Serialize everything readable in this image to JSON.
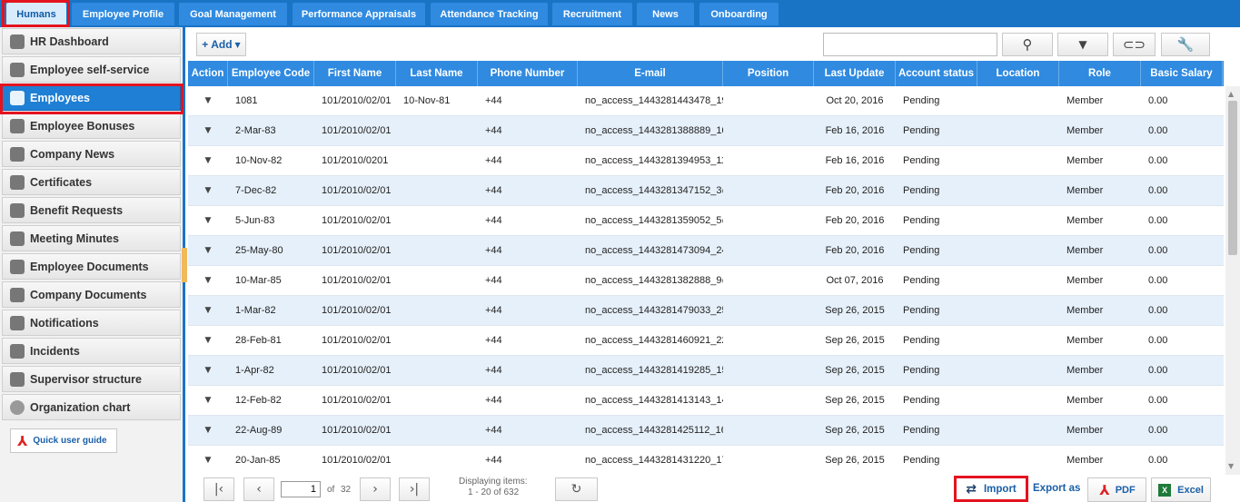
{
  "top_nav": {
    "tabs": [
      {
        "label": "Humans"
      },
      {
        "label": "Employee Profile"
      },
      {
        "label": "Goal Management"
      },
      {
        "label": "Performance Appraisals"
      },
      {
        "label": "Attendance Tracking"
      },
      {
        "label": "Recruitment"
      },
      {
        "label": "News"
      },
      {
        "label": "Onboarding"
      }
    ],
    "active_tab": "Humans"
  },
  "sidebar": {
    "items": [
      {
        "label": "HR Dashboard",
        "icon": "dashboard-icon"
      },
      {
        "label": "Employee self-service",
        "icon": "person-icon"
      },
      {
        "label": "Employees",
        "icon": "employee-card-icon"
      },
      {
        "label": "Employee Bonuses",
        "icon": "bonus-icon"
      },
      {
        "label": "Company News",
        "icon": "newspaper-icon"
      },
      {
        "label": "Certificates",
        "icon": "certificate-icon"
      },
      {
        "label": "Benefit Requests",
        "icon": "stack-icon"
      },
      {
        "label": "Meeting Minutes",
        "icon": "notepad-icon"
      },
      {
        "label": "Employee Documents",
        "icon": "document-icon"
      },
      {
        "label": "Company Documents",
        "icon": "document-icon"
      },
      {
        "label": "Notifications",
        "icon": "building-icon"
      },
      {
        "label": "Incidents",
        "icon": "incident-icon"
      },
      {
        "label": "Supervisor structure",
        "icon": "hierarchy-icon"
      },
      {
        "label": "Organization chart",
        "icon": "circle-icon"
      }
    ],
    "active_item": "Employees",
    "guide_label": "Quick user guide"
  },
  "toolbar": {
    "add_label": "+ Add",
    "search_value": ""
  },
  "grid": {
    "columns": [
      "Action",
      "Employee Code",
      "First Name",
      "Last Name",
      "Phone Number",
      "E-mail",
      "Position",
      "Last Update",
      "Account status",
      "Location",
      "Role",
      "Basic Salary"
    ],
    "rows": [
      {
        "code": "1081",
        "first": "101/2010/02/01",
        "last": "10-Nov-81",
        "phone": "+44",
        "email": "no_access_1443281443478_19",
        "position": "",
        "updated": "Oct 20, 2016",
        "status": "Pending",
        "location": "",
        "role": "Member",
        "salary": "0.00"
      },
      {
        "code": "2-Mar-83",
        "first": "101/2010/02/01",
        "last": "",
        "phone": "+44",
        "email": "no_access_1443281388889_10",
        "position": "",
        "updated": "Feb 16, 2016",
        "status": "Pending",
        "location": "",
        "role": "Member",
        "salary": "0.00"
      },
      {
        "code": "10-Nov-82",
        "first": "101/2010/0201",
        "last": "",
        "phone": "+44",
        "email": "no_access_1443281394953_11",
        "position": "",
        "updated": "Feb 16, 2016",
        "status": "Pending",
        "location": "",
        "role": "Member",
        "salary": "0.00"
      },
      {
        "code": "7-Dec-82",
        "first": "101/2010/02/01",
        "last": "",
        "phone": "+44",
        "email": "no_access_1443281347152_3@",
        "position": "",
        "updated": "Feb 20, 2016",
        "status": "Pending",
        "location": "",
        "role": "Member",
        "salary": "0.00"
      },
      {
        "code": "5-Jun-83",
        "first": "101/2010/02/01",
        "last": "",
        "phone": "+44",
        "email": "no_access_1443281359052_5@",
        "position": "",
        "updated": "Feb 20, 2016",
        "status": "Pending",
        "location": "",
        "role": "Member",
        "salary": "0.00"
      },
      {
        "code": "25-May-80",
        "first": "101/2010/02/01",
        "last": "",
        "phone": "+44",
        "email": "no_access_1443281473094_24",
        "position": "",
        "updated": "Feb 20, 2016",
        "status": "Pending",
        "location": "",
        "role": "Member",
        "salary": "0.00"
      },
      {
        "code": "10-Mar-85",
        "first": "101/2010/02/01",
        "last": "",
        "phone": "+44",
        "email": "no_access_1443281382888_9@",
        "position": "",
        "updated": "Oct 07, 2016",
        "status": "Pending",
        "location": "",
        "role": "Member",
        "salary": "0.00"
      },
      {
        "code": "1-Mar-82",
        "first": "101/2010/02/01",
        "last": "",
        "phone": "+44",
        "email": "no_access_1443281479033_25",
        "position": "",
        "updated": "Sep 26, 2015",
        "status": "Pending",
        "location": "",
        "role": "Member",
        "salary": "0.00"
      },
      {
        "code": "28-Feb-81",
        "first": "101/2010/02/01",
        "last": "",
        "phone": "+44",
        "email": "no_access_1443281460921_22",
        "position": "",
        "updated": "Sep 26, 2015",
        "status": "Pending",
        "location": "",
        "role": "Member",
        "salary": "0.00"
      },
      {
        "code": "1-Apr-82",
        "first": "101/2010/02/01",
        "last": "",
        "phone": "+44",
        "email": "no_access_1443281419285_15",
        "position": "",
        "updated": "Sep 26, 2015",
        "status": "Pending",
        "location": "",
        "role": "Member",
        "salary": "0.00"
      },
      {
        "code": "12-Feb-82",
        "first": "101/2010/02/01",
        "last": "",
        "phone": "+44",
        "email": "no_access_1443281413143_14",
        "position": "",
        "updated": "Sep 26, 2015",
        "status": "Pending",
        "location": "",
        "role": "Member",
        "salary": "0.00"
      },
      {
        "code": "22-Aug-89",
        "first": "101/2010/02/01",
        "last": "",
        "phone": "+44",
        "email": "no_access_1443281425112_16",
        "position": "",
        "updated": "Sep 26, 2015",
        "status": "Pending",
        "location": "",
        "role": "Member",
        "salary": "0.00"
      },
      {
        "code": "20-Jan-85",
        "first": "101/2010/02/01",
        "last": "",
        "phone": "+44",
        "email": "no_access_1443281431220_17",
        "position": "",
        "updated": "Sep 26, 2015",
        "status": "Pending",
        "location": "",
        "role": "Member",
        "salary": "0.00"
      }
    ]
  },
  "pager": {
    "current_page": "1",
    "of_label": "of",
    "total_pages": "32",
    "display_label": "Displaying items:",
    "display_range": "1 - 20 of 632"
  },
  "actions": {
    "import_label": "Import",
    "export_label": "Export as",
    "pdf_label": "PDF",
    "excel_label": "Excel"
  },
  "colors": {
    "brand_blue": "#1a74c6",
    "header_blue": "#2f8ae0",
    "highlight_red": "#e3141f"
  }
}
